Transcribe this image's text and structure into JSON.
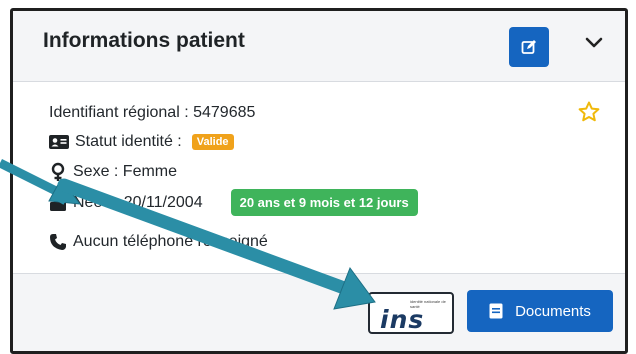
{
  "card": {
    "title": "Informations patient",
    "edit_icon": "edit-icon",
    "collapse_icon": "chevron-down-icon"
  },
  "patient": {
    "identifier": "Identifiant régional : 5479685",
    "identity_status_label": "Statut identité :",
    "identity_status_value": "Valide",
    "sex": "Sexe : Femme",
    "birth": "Née le 20/11/2004",
    "age": "20 ans et 9 mois et 12 jours",
    "phone": "Aucun téléphone renseigné",
    "favorite_icon": "star-icon"
  },
  "footer": {
    "ins_logo_text": "ins",
    "ins_small_text": "identité nationale de santé",
    "documents_label": "Documents"
  },
  "colors": {
    "primary": "#1565c0",
    "valid_badge": "#f0a21b",
    "age_badge": "#3fb45b",
    "arrow": "#2b8ea6",
    "star": "#f0b90b"
  }
}
